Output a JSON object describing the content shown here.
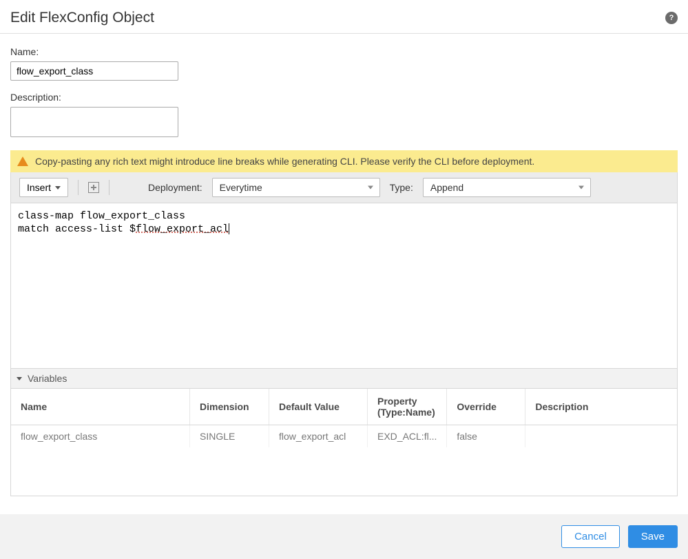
{
  "header": {
    "title": "Edit FlexConfig Object",
    "help_glyph": "?"
  },
  "form": {
    "name_label": "Name:",
    "name_value": "flow_export_class",
    "description_label": "Description:",
    "description_value": ""
  },
  "warning": {
    "text": "Copy-pasting any rich text might introduce line breaks while generating CLI. Please verify the CLI before deployment."
  },
  "toolbar": {
    "insert_label": "Insert",
    "deployment_label": "Deployment:",
    "deployment_value": "Everytime",
    "type_label": "Type:",
    "type_value": "Append"
  },
  "code": {
    "line1": "class-map flow_export_class",
    "line2_prefix": "match access-list $",
    "line2_var": "flow_export_acl"
  },
  "variables": {
    "section_label": "Variables",
    "columns": {
      "name": "Name",
      "dimension": "Dimension",
      "default_value": "Default Value",
      "property_l1": "Property",
      "property_l2": "(Type:Name)",
      "override": "Override",
      "description": "Description"
    },
    "rows": [
      {
        "name": "flow_export_class",
        "dimension": "SINGLE",
        "default_value": "flow_export_acl",
        "property": "EXD_ACL:fl...",
        "override": "false",
        "description": ""
      }
    ]
  },
  "footer": {
    "cancel": "Cancel",
    "save": "Save"
  }
}
